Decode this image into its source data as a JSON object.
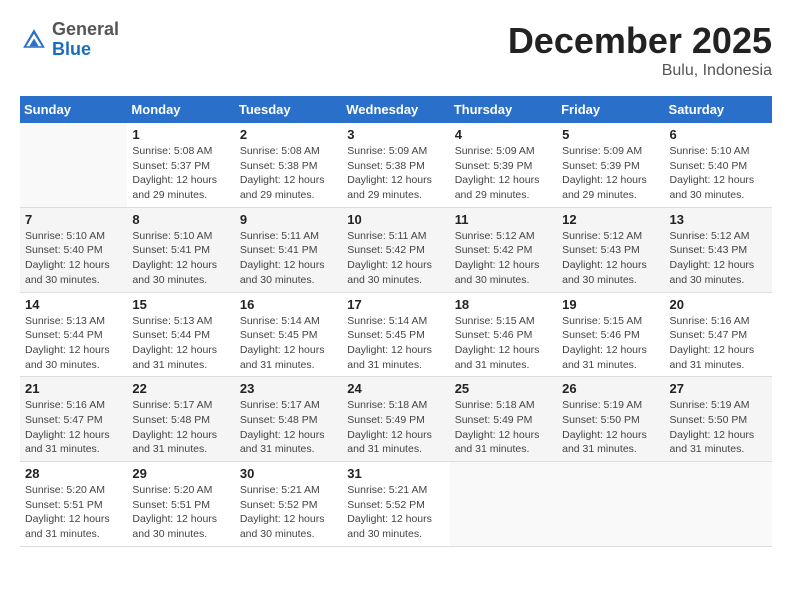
{
  "header": {
    "logo_general": "General",
    "logo_blue": "Blue",
    "month_title": "December 2025",
    "location": "Bulu, Indonesia"
  },
  "days_of_week": [
    "Sunday",
    "Monday",
    "Tuesday",
    "Wednesday",
    "Thursday",
    "Friday",
    "Saturday"
  ],
  "weeks": [
    [
      {
        "day": "",
        "info": ""
      },
      {
        "day": "1",
        "info": "Sunrise: 5:08 AM\nSunset: 5:37 PM\nDaylight: 12 hours\nand 29 minutes."
      },
      {
        "day": "2",
        "info": "Sunrise: 5:08 AM\nSunset: 5:38 PM\nDaylight: 12 hours\nand 29 minutes."
      },
      {
        "day": "3",
        "info": "Sunrise: 5:09 AM\nSunset: 5:38 PM\nDaylight: 12 hours\nand 29 minutes."
      },
      {
        "day": "4",
        "info": "Sunrise: 5:09 AM\nSunset: 5:39 PM\nDaylight: 12 hours\nand 29 minutes."
      },
      {
        "day": "5",
        "info": "Sunrise: 5:09 AM\nSunset: 5:39 PM\nDaylight: 12 hours\nand 29 minutes."
      },
      {
        "day": "6",
        "info": "Sunrise: 5:10 AM\nSunset: 5:40 PM\nDaylight: 12 hours\nand 30 minutes."
      }
    ],
    [
      {
        "day": "7",
        "info": "Sunrise: 5:10 AM\nSunset: 5:40 PM\nDaylight: 12 hours\nand 30 minutes."
      },
      {
        "day": "8",
        "info": "Sunrise: 5:10 AM\nSunset: 5:41 PM\nDaylight: 12 hours\nand 30 minutes."
      },
      {
        "day": "9",
        "info": "Sunrise: 5:11 AM\nSunset: 5:41 PM\nDaylight: 12 hours\nand 30 minutes."
      },
      {
        "day": "10",
        "info": "Sunrise: 5:11 AM\nSunset: 5:42 PM\nDaylight: 12 hours\nand 30 minutes."
      },
      {
        "day": "11",
        "info": "Sunrise: 5:12 AM\nSunset: 5:42 PM\nDaylight: 12 hours\nand 30 minutes."
      },
      {
        "day": "12",
        "info": "Sunrise: 5:12 AM\nSunset: 5:43 PM\nDaylight: 12 hours\nand 30 minutes."
      },
      {
        "day": "13",
        "info": "Sunrise: 5:12 AM\nSunset: 5:43 PM\nDaylight: 12 hours\nand 30 minutes."
      }
    ],
    [
      {
        "day": "14",
        "info": "Sunrise: 5:13 AM\nSunset: 5:44 PM\nDaylight: 12 hours\nand 30 minutes."
      },
      {
        "day": "15",
        "info": "Sunrise: 5:13 AM\nSunset: 5:44 PM\nDaylight: 12 hours\nand 31 minutes."
      },
      {
        "day": "16",
        "info": "Sunrise: 5:14 AM\nSunset: 5:45 PM\nDaylight: 12 hours\nand 31 minutes."
      },
      {
        "day": "17",
        "info": "Sunrise: 5:14 AM\nSunset: 5:45 PM\nDaylight: 12 hours\nand 31 minutes."
      },
      {
        "day": "18",
        "info": "Sunrise: 5:15 AM\nSunset: 5:46 PM\nDaylight: 12 hours\nand 31 minutes."
      },
      {
        "day": "19",
        "info": "Sunrise: 5:15 AM\nSunset: 5:46 PM\nDaylight: 12 hours\nand 31 minutes."
      },
      {
        "day": "20",
        "info": "Sunrise: 5:16 AM\nSunset: 5:47 PM\nDaylight: 12 hours\nand 31 minutes."
      }
    ],
    [
      {
        "day": "21",
        "info": "Sunrise: 5:16 AM\nSunset: 5:47 PM\nDaylight: 12 hours\nand 31 minutes."
      },
      {
        "day": "22",
        "info": "Sunrise: 5:17 AM\nSunset: 5:48 PM\nDaylight: 12 hours\nand 31 minutes."
      },
      {
        "day": "23",
        "info": "Sunrise: 5:17 AM\nSunset: 5:48 PM\nDaylight: 12 hours\nand 31 minutes."
      },
      {
        "day": "24",
        "info": "Sunrise: 5:18 AM\nSunset: 5:49 PM\nDaylight: 12 hours\nand 31 minutes."
      },
      {
        "day": "25",
        "info": "Sunrise: 5:18 AM\nSunset: 5:49 PM\nDaylight: 12 hours\nand 31 minutes."
      },
      {
        "day": "26",
        "info": "Sunrise: 5:19 AM\nSunset: 5:50 PM\nDaylight: 12 hours\nand 31 minutes."
      },
      {
        "day": "27",
        "info": "Sunrise: 5:19 AM\nSunset: 5:50 PM\nDaylight: 12 hours\nand 31 minutes."
      }
    ],
    [
      {
        "day": "28",
        "info": "Sunrise: 5:20 AM\nSunset: 5:51 PM\nDaylight: 12 hours\nand 31 minutes."
      },
      {
        "day": "29",
        "info": "Sunrise: 5:20 AM\nSunset: 5:51 PM\nDaylight: 12 hours\nand 30 minutes."
      },
      {
        "day": "30",
        "info": "Sunrise: 5:21 AM\nSunset: 5:52 PM\nDaylight: 12 hours\nand 30 minutes."
      },
      {
        "day": "31",
        "info": "Sunrise: 5:21 AM\nSunset: 5:52 PM\nDaylight: 12 hours\nand 30 minutes."
      },
      {
        "day": "",
        "info": ""
      },
      {
        "day": "",
        "info": ""
      },
      {
        "day": "",
        "info": ""
      }
    ]
  ]
}
